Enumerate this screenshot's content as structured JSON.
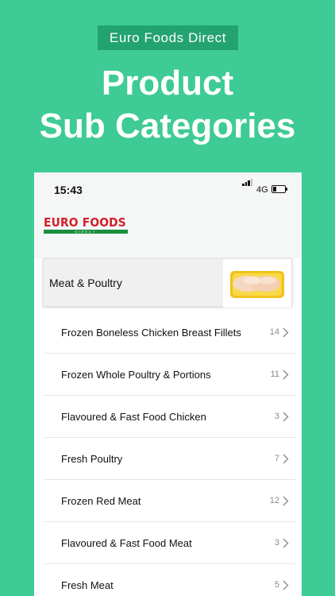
{
  "banner": {
    "badge": "Euro Foods Direct",
    "title_line1": "Product",
    "title_line2": "Sub Categories"
  },
  "status_bar": {
    "time": "15:43",
    "network": "4G"
  },
  "logo": {
    "name": "EURO FOODS",
    "tagline": "DIRECT"
  },
  "category": {
    "title": "Meat & Poultry"
  },
  "subcategories": [
    {
      "label": "Frozen Boneless Chicken Breast Fillets",
      "count": "14"
    },
    {
      "label": "Frozen Whole Poultry & Portions",
      "count": "11"
    },
    {
      "label": "Flavoured & Fast Food Chicken",
      "count": "3"
    },
    {
      "label": "Fresh Poultry",
      "count": "7"
    },
    {
      "label": "Frozen Red Meat",
      "count": "12"
    },
    {
      "label": "Flavoured & Fast Food Meat",
      "count": "3"
    },
    {
      "label": "Fresh Meat",
      "count": "5"
    }
  ],
  "colors": {
    "background": "#3ecb95",
    "badge": "#23a371",
    "logo_red": "#d4202b",
    "logo_green": "#1b8e3e"
  }
}
